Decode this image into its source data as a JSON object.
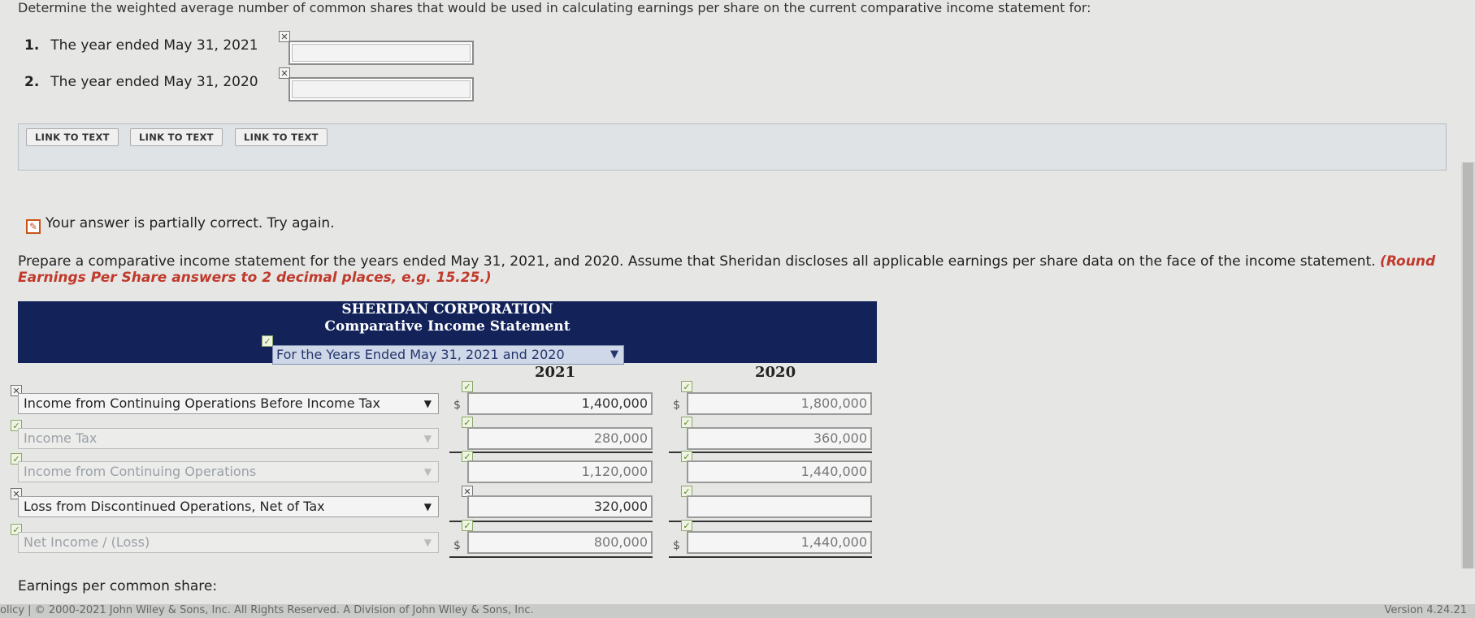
{
  "question": {
    "intro": "Determine the weighted average number of common shares that would be used in calculating earnings per share on the current comparative income statement for:",
    "items": [
      {
        "num": "1.",
        "label": "The year ended May 31, 2021",
        "value": ""
      },
      {
        "num": "2.",
        "label": "The year ended May 31, 2020",
        "value": ""
      }
    ],
    "links": [
      "LINK TO TEXT",
      "LINK TO TEXT",
      "LINK TO TEXT"
    ]
  },
  "status": {
    "icon": "pencil-icon",
    "text": "Your answer is partially correct.  Try again."
  },
  "instructions": {
    "main": "Prepare a comparative income statement for the years ended May 31, 2021, and 2020. Assume that Sheridan discloses all applicable earnings per share data on the face of the income statement.",
    "highlight": "(Round Earnings Per Share answers to 2 decimal places, e.g. 15.25.)"
  },
  "statement": {
    "company": "SHERIDAN CORPORATION",
    "title": "Comparative Income Statement",
    "period": "For the Years Ended May 31, 2021 and 2020",
    "year1": "2021",
    "year2": "2020",
    "currency": "$",
    "rows": [
      {
        "label": "Income from Continuing Operations Before Income Tax",
        "v2021": "1,400,000",
        "v2020": "1,800,000"
      },
      {
        "label": "Income Tax",
        "v2021": "280,000",
        "v2020": "360,000"
      },
      {
        "label": "Income from Continuing Operations",
        "v2021": "1,120,000",
        "v2020": "1,440,000"
      },
      {
        "label": "Loss from Discontinued Operations, Net of Tax",
        "v2021": "320,000",
        "v2020": ""
      },
      {
        "label": "Net Income / (Loss)",
        "v2021": "800,000",
        "v2020": "1,440,000"
      }
    ]
  },
  "eps_label": "Earnings per common share:",
  "footer": {
    "left": "olicy  |  © 2000-2021 John Wiley & Sons, Inc. All Rights Reserved. A Division of John Wiley & Sons, Inc.",
    "version": "Version 4.24.21"
  },
  "colors": {
    "header_bg": "#13235a",
    "accent_red": "#c0392b"
  }
}
